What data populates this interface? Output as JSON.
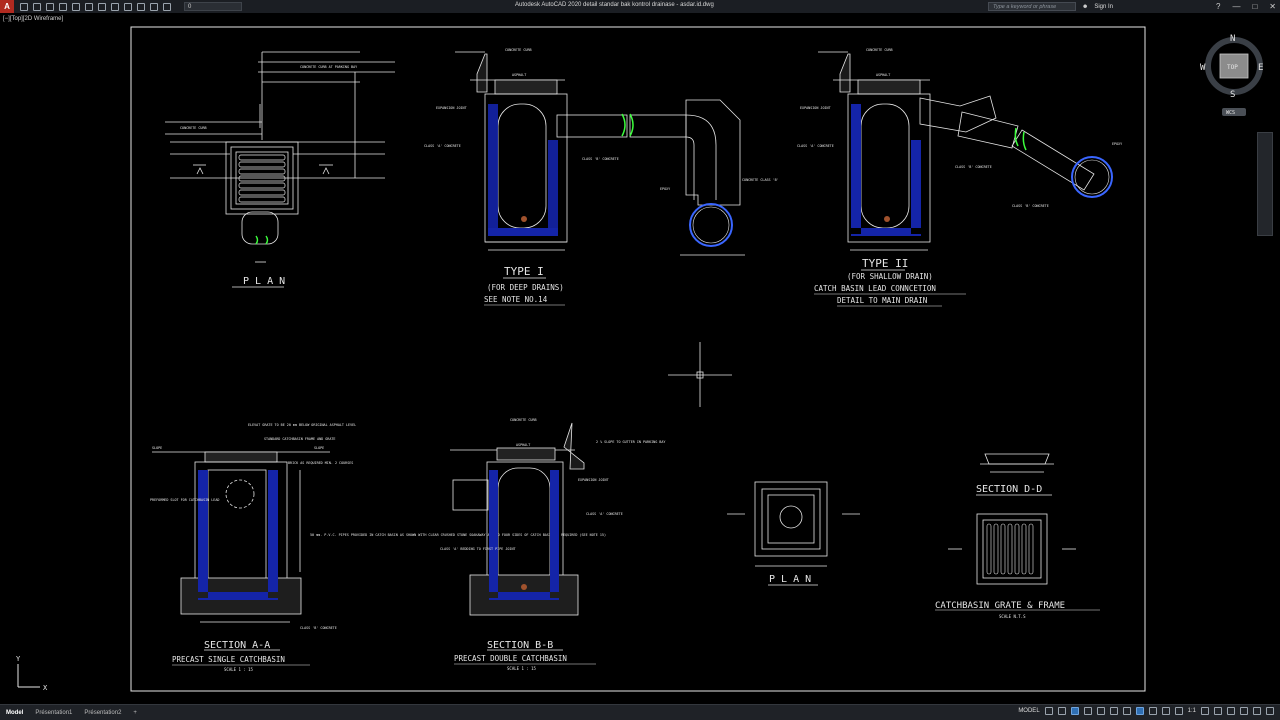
{
  "titlebar": {
    "app_letter": "A",
    "title": "Autodesk AutoCAD 2020    detail standar bak kontrol drainase - asdar.id.dwg",
    "layer_value": "0",
    "search_placeholder": "Type a keyword or phrase",
    "signin": "Sign In"
  },
  "viewport_label": "[−][Top][2D Wireframe]",
  "viewcube": {
    "north": "N",
    "south": "S",
    "east": "E",
    "west": "W",
    "top": "TOP",
    "wcs": "WCS"
  },
  "ucs": {
    "x": "X",
    "y": "Y"
  },
  "drawing": {
    "plan_top": "P L A N",
    "typeI_title": "TYPE I",
    "typeI_sub1": "(FOR DEEP DRAINS)",
    "typeI_sub2": "SEE NOTE NO.14",
    "typeII_title": "TYPE II",
    "typeII_sub1": "(FOR SHALLOW DRAIN)",
    "typeII_sub2": "CATCH BASIN LEAD CONNCETION",
    "typeII_sub3": "DETAIL TO MAIN DRAIN",
    "sectionAA_title": "SECTION A-A",
    "sectionAA_sub": "PRECAST SINGLE CATCHBASIN",
    "sectionAA_scale": "SCALE 1 : 15",
    "sectionBB_title": "SECTION B-B",
    "sectionBB_sub": "PRECAST DOUBLE CATCHBASIN",
    "sectionBB_scale": "SCALE 1 : 15",
    "plan_small": "P L A N",
    "sectionDD_title": "SECTION D-D",
    "grate_title": "CATCHBASIN GRATE & FRAME",
    "grate_scale": "SCALE N.T.S",
    "notes": {
      "concrete_curb": "CONCRETE CURB",
      "curb_parking": "CONCRETE CURB AT PARKING BAY",
      "asphalt": "ASPHALT",
      "expansion_joint": "EXPANSION JOINT",
      "class_a": "CLASS 'A' CONCRETE",
      "class_b": "CLASS 'B' CONCRETE",
      "concrete_class_b": "CONCRETE CLASS 'B'",
      "epoxy": "EPOXY",
      "slope": "SLOPE",
      "brick": "BRICK AS REQUIRED MIN. 2 COURSES",
      "elevate": "ELEVAT GRATE TO BE 20 mm BELOW ORIGINAL ASPHALT LEVEL",
      "frame": "STANDARD CATCHBASIN FRAME AND GRATE",
      "preformed": "PREFORMED SLOT FOR CATCHBASIN LEAD",
      "pvc": "50 mm. P.V.C. PIPES PROVIDED IN CATCH BASIN AS SHOWN WITH CLEAR CRUSHED STONE SOAKAWAY AROUND FOUR SIDES OF CATCH BASIN IF REQUIRED (SEE NOTE 15)",
      "gutter": "2 % SLOPE TO GUTTER IN PARKING BAY",
      "bedding": "CLASS 'A' BEDDING TO FIRST PIPE JOINT"
    }
  },
  "statusbar": {
    "tabs": [
      "Model",
      "Présentation1",
      "Présentation2"
    ],
    "model_label": "MODEL",
    "scale": "1:1"
  }
}
